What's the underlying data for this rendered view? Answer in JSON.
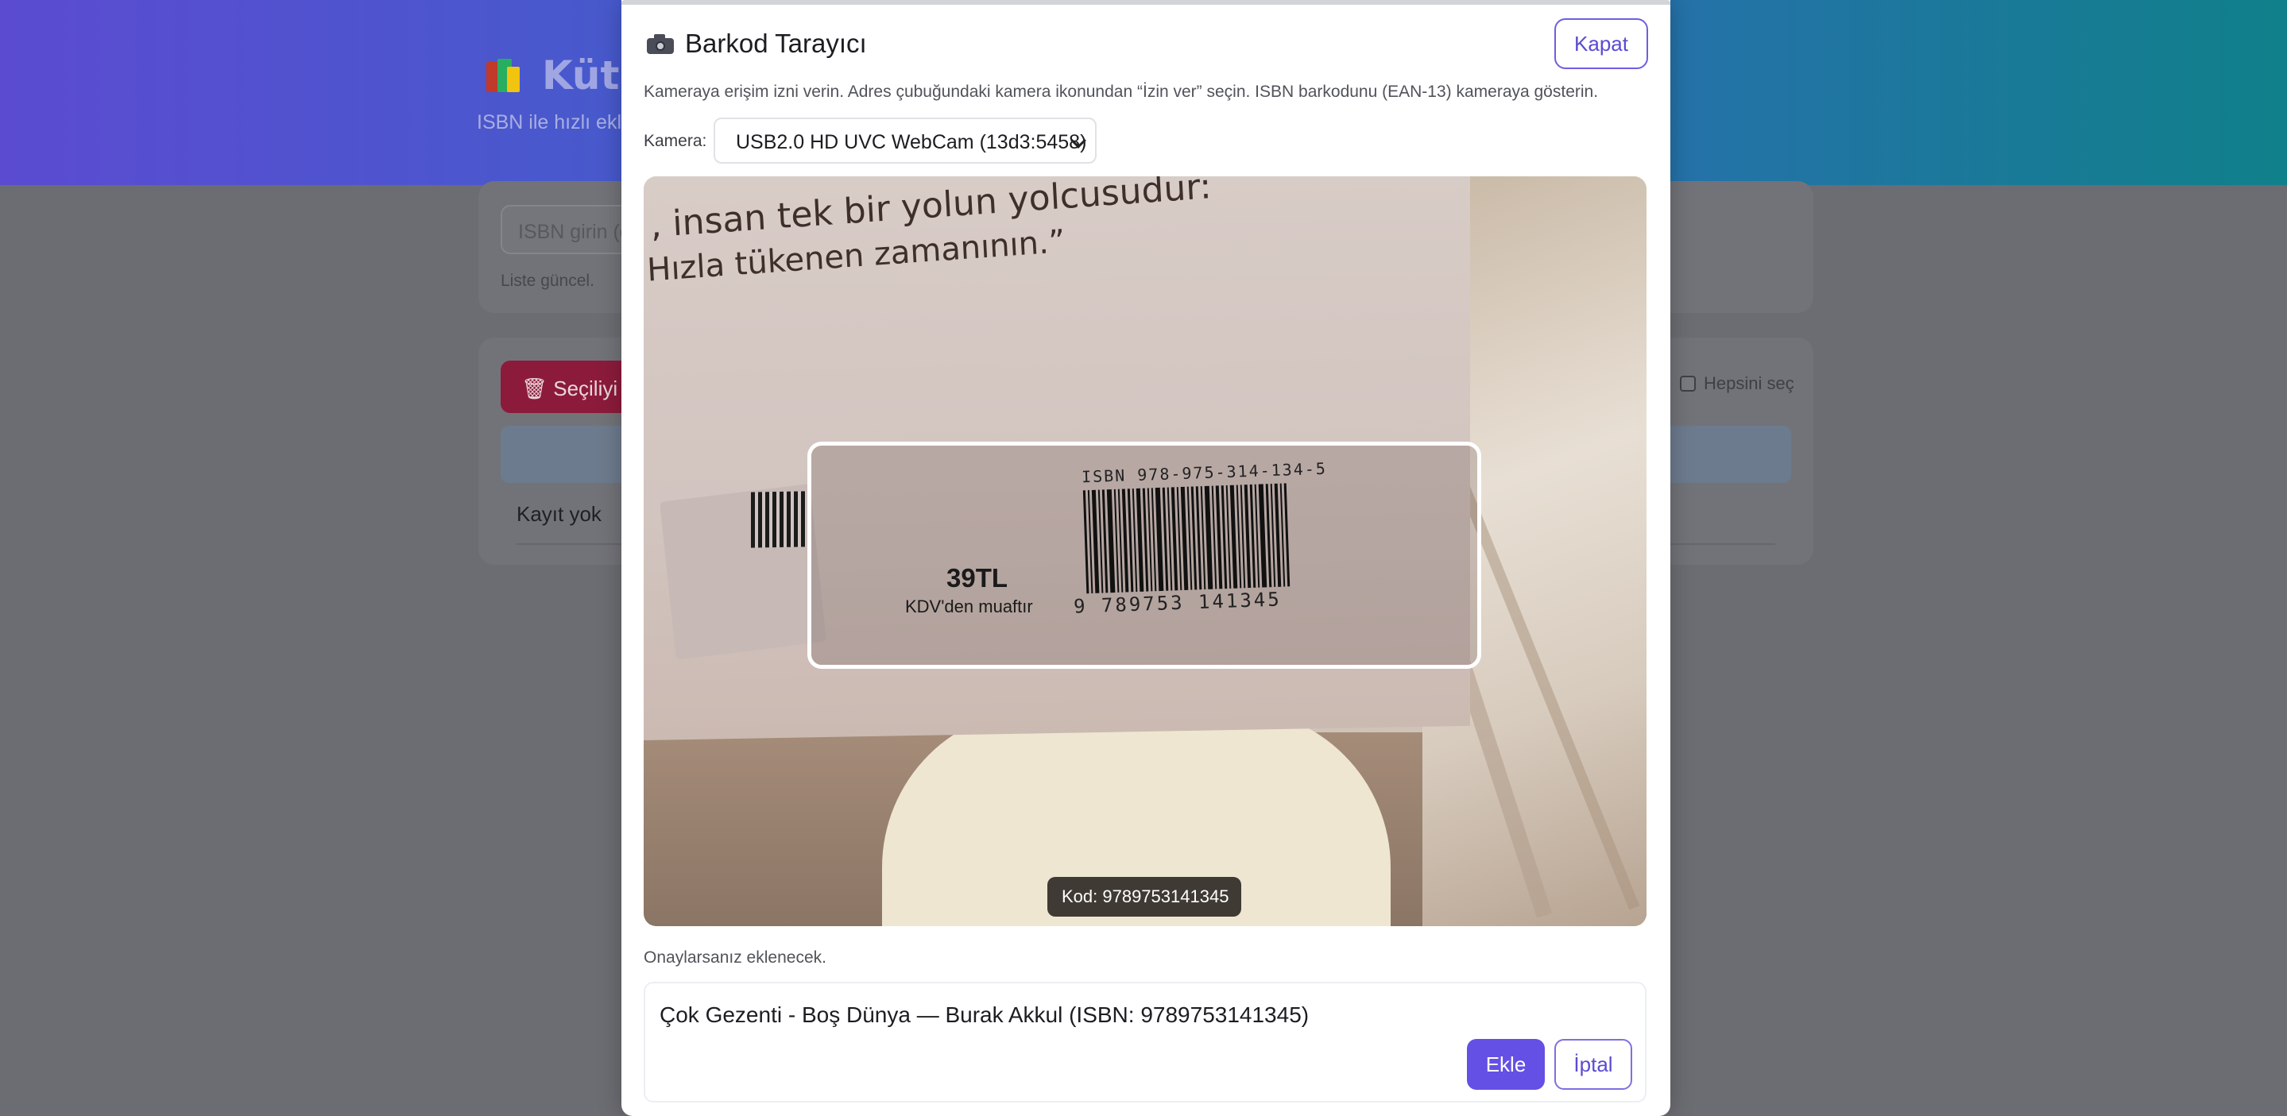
{
  "background": {
    "title": "Kütü",
    "subtitle": "ISBN ile hızlı ekle",
    "isbn_input_placeholder": "ISBN girin (ö",
    "list_status": "Liste güncel.",
    "delete_selected_label": "🗑 Seçiliyi S",
    "select_all_label": "Hepsini seç",
    "empty_state": "Kayıt yok"
  },
  "modal": {
    "title": "Barkod Tarayıcı",
    "close_label": "Kapat",
    "instructions": "Kameraya erişim izni verin. Adres çubuğundaki kamera ikonundan “İzin ver” seçin. ISBN barkodunu (EAN-13) kameraya gösterin.",
    "camera_label": "Kamera:",
    "camera_selected": "USB2.0 HD UVC WebCam (13d3:5458)",
    "detected_code": "Kod: 9789753141345",
    "confirm_hint": "Onaylarsanız eklenecek.",
    "result_text": "Çok Gezenti - Boş Dünya — Burak Akkul (ISBN: 9789753141345)",
    "add_label": "Ekle",
    "cancel_label": "İptal"
  },
  "camera_feed": {
    "quote_line1": ", insan tek bir yolun yolcusudur:",
    "quote_line2": "Hızla tükenen zamanının.”",
    "price": "39TL",
    "tax_note": "KDV'den muaftır",
    "isbn_printed": "ISBN 978-975-314-134-5",
    "barcode_digits": "9  789753   141345"
  },
  "colors": {
    "accent": "#6450e4",
    "header_gradient_start": "#5b4bd1",
    "header_gradient_end": "#10808a"
  }
}
